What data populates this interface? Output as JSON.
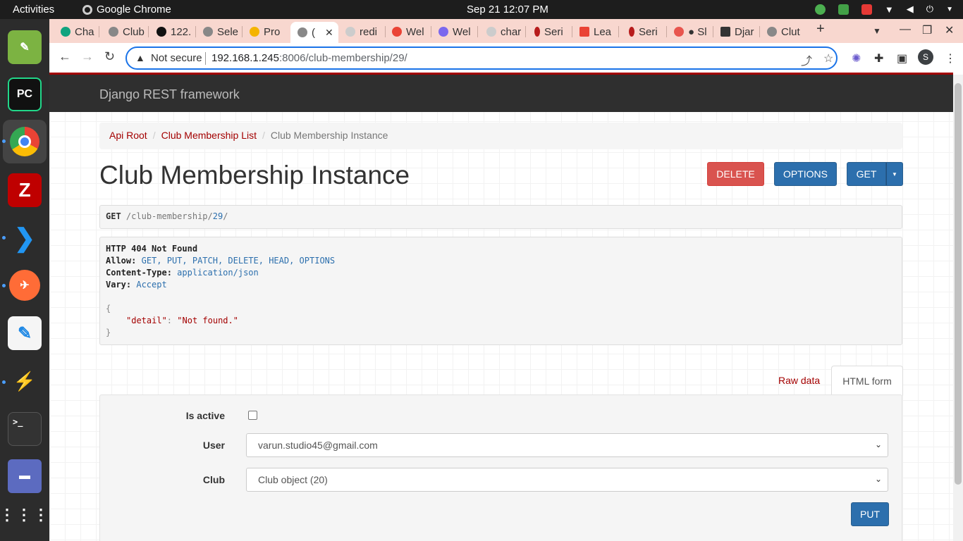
{
  "system": {
    "activities": "Activities",
    "app_name": "Google Chrome",
    "clock": "Sep 21  12:07 PM"
  },
  "tabs": [
    {
      "label": "Cha",
      "color": "#10a37f"
    },
    {
      "label": "Club",
      "color": "#888888"
    },
    {
      "label": "122.",
      "color": "#111111"
    },
    {
      "label": "Sele",
      "color": "#888888"
    },
    {
      "label": "Pro",
      "color": "#f4b400"
    },
    {
      "label": "(",
      "color": "#888888"
    },
    {
      "label": "redi",
      "color": "#cccccc"
    },
    {
      "label": "Wel",
      "color": "#ea4335"
    },
    {
      "label": "Wel",
      "color": "#7b68ee"
    },
    {
      "label": "char",
      "color": "#cccccc"
    },
    {
      "label": "Seri",
      "color": "#b71c1c"
    },
    {
      "label": "Lea",
      "color": "#ea4335"
    },
    {
      "label": "Seri",
      "color": "#b71c1c"
    },
    {
      "label": "● Sl",
      "color": "#e8554e"
    },
    {
      "label": "Djar",
      "color": "#333333"
    },
    {
      "label": "Clut",
      "color": "#888888"
    }
  ],
  "omnibox": {
    "security_label": "Not secure",
    "host": "192.168.1.245",
    "path": ":8006/club-membership/29/"
  },
  "profile_initial": "S",
  "drf": {
    "brand": "Django REST framework",
    "breadcrumb": [
      "Api Root",
      "Club Membership List",
      "Club Membership Instance"
    ],
    "title": "Club Membership Instance",
    "buttons": {
      "delete": "DELETE",
      "options": "OPTIONS",
      "get": "GET"
    },
    "request": {
      "method": "GET",
      "path_prefix": "/club-membership/",
      "id": "29",
      "path_suffix": "/"
    },
    "response": {
      "status": "HTTP 404 Not Found",
      "allow_key": "Allow:",
      "allow_val": "GET, PUT, PATCH, DELETE, HEAD, OPTIONS",
      "ctype_key": "Content-Type:",
      "ctype_val": "application/json",
      "vary_key": "Vary:",
      "vary_val": "Accept",
      "open_brace": "{",
      "body_key": "\"detail\"",
      "body_colon": ":",
      "body_val": "\"Not found.\"",
      "close_brace": "}"
    },
    "form_tabs": {
      "raw": "Raw data",
      "html": "HTML form"
    },
    "form": {
      "is_active_label": "Is active",
      "user_label": "User",
      "user_value": "varun.studio45@gmail.com",
      "club_label": "Club",
      "club_value": "Club object (20)",
      "put": "PUT"
    }
  }
}
